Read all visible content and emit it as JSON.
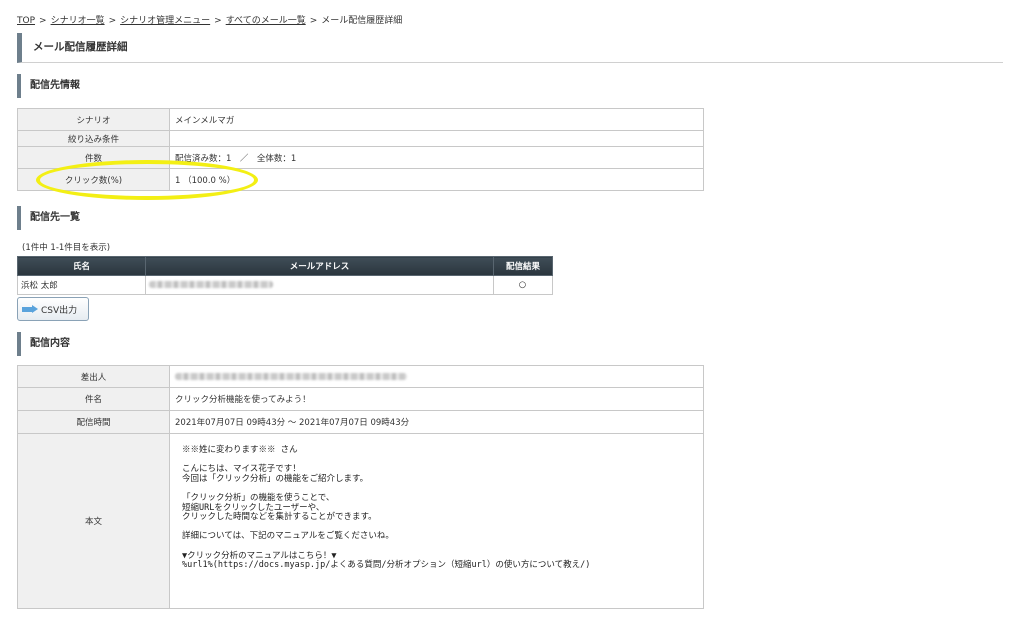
{
  "breadcrumb": {
    "items": [
      "TOP",
      "シナリオ一覧",
      "シナリオ管理メニュー",
      "すべてのメール一覧"
    ],
    "current": "メール配信履歴詳細",
    "separator": ">"
  },
  "page_title": "メール配信履歴詳細",
  "destination_info": {
    "heading": "配信先情報",
    "rows": [
      {
        "label": "シナリオ",
        "value": "メインメルマガ"
      },
      {
        "label": "絞り込み条件",
        "value": ""
      },
      {
        "label": "件数",
        "value": "配信済み数：1　／　全体数：1"
      },
      {
        "label": "クリック数(%)",
        "value": "1 （100.0 %）"
      }
    ]
  },
  "destination_list": {
    "heading": "配信先一覧",
    "count_text": "(1件中 1-1件目を表示)",
    "columns": [
      "氏名",
      "メールアドレス",
      "配信結果"
    ],
    "rows": [
      {
        "name": "浜松 太郎",
        "email": "",
        "result": "○"
      }
    ]
  },
  "csv_button": "CSV出力",
  "content": {
    "heading": "配信内容",
    "rows": [
      {
        "label": "差出人",
        "value": ""
      },
      {
        "label": "件名",
        "value": "クリック分析機能を使ってみよう！"
      },
      {
        "label": "配信時間",
        "value": "2021年07月07日 09時43分 〜 2021年07月07日 09時43分"
      }
    ],
    "body_label": "本文",
    "body": "※※姓に変わります※※ さん\n\nこんにちは、マイス花子です！\n今回は「クリック分析」の機能をご紹介します。\n\n「クリック分析」の機能を使うことで、\n短縮URLをクリックしたユーザーや、\nクリックした時間などを集計することができます。\n\n詳細については、下記のマニュアルをご覧くださいね。\n\n▼クリック分析のマニュアルはこちら！▼\n%url1%(https://docs.myasp.jp/よくある質問/分析オプション（短縮url）の使い方について教え/)"
  },
  "colors": {
    "accent_bar": "#6e7f8c",
    "table_header": "#2f3b44",
    "highlight": "#f3ef14"
  }
}
